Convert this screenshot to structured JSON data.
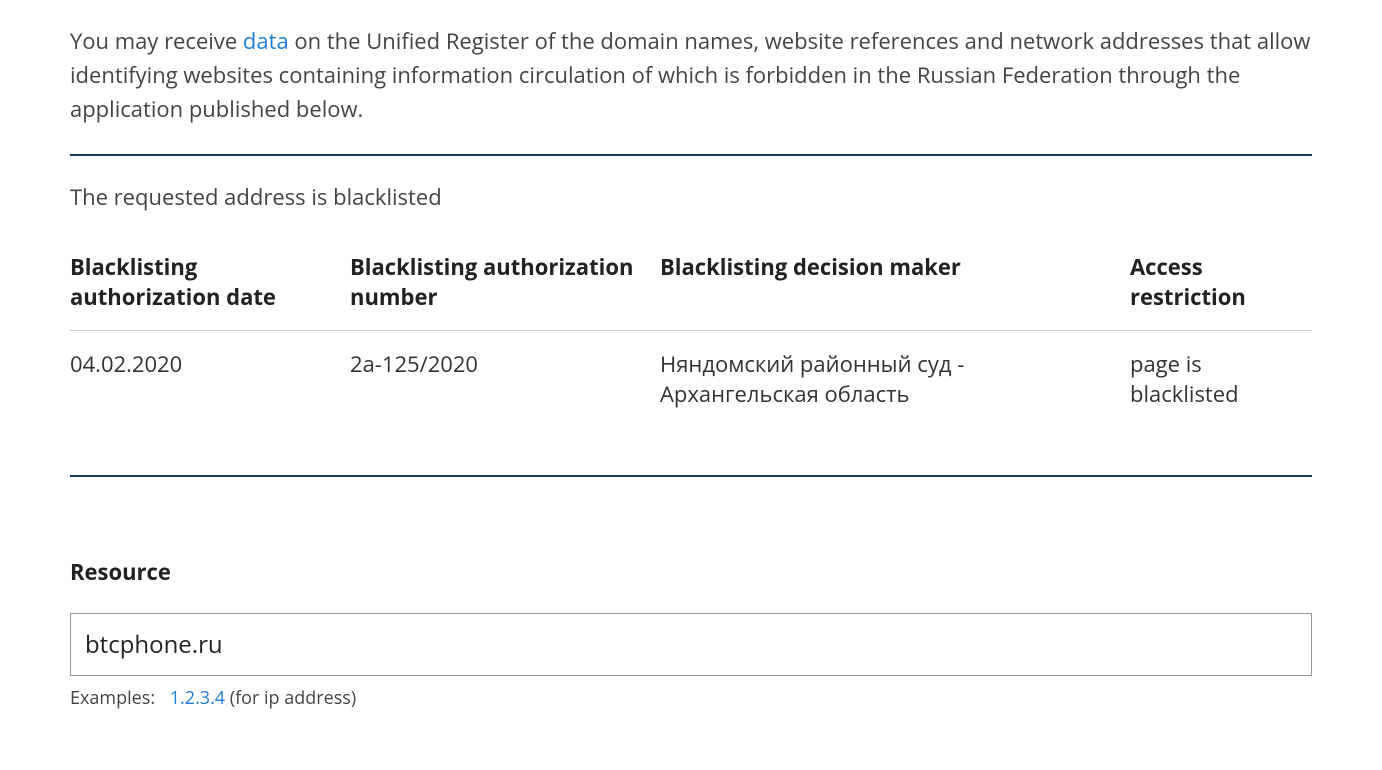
{
  "intro": {
    "prefix": "You may receive ",
    "link": "data",
    "suffix": " on the Unified Register of the domain names, website references and network addresses that allow identifying websites containing information circulation of which is forbidden in the Russian Federation through the application published below."
  },
  "status_message": "The requested address is blacklisted",
  "table": {
    "headers": {
      "date": "Blacklisting authorization date",
      "number": "Blacklisting authorization number",
      "maker": "Blacklisting decision maker",
      "restriction": "Access restriction"
    },
    "row": {
      "date": "04.02.2020",
      "number": "2а-125/2020",
      "maker": "Няндомский районный суд - Архангельская область",
      "restriction": "page is blacklisted"
    }
  },
  "resource": {
    "label": "Resource",
    "value": "btcphone.ru"
  },
  "examples": {
    "label": "Examples:",
    "ip_link": "1.2.3.4",
    "ip_note": " (for ip address)"
  }
}
